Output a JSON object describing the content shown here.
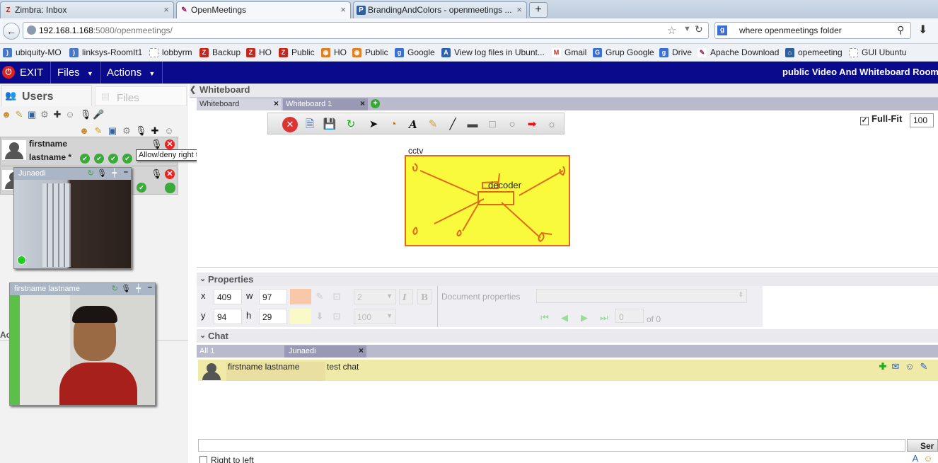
{
  "browser": {
    "tabs": [
      {
        "label": "Zimbra: Inbox",
        "favicon": "Z"
      },
      {
        "label": "OpenMeetings",
        "favicon": "feather"
      },
      {
        "label": "BrandingAndColors - openmeetings ...",
        "favicon": "P"
      }
    ],
    "new_tab": "+",
    "url_host": "192.168.1.168",
    "url_rest": ":5080/openmeetings/",
    "search_value": "where openmeetings folder",
    "bookmarks": [
      "ubiquity-MO",
      "linksys-RoomIt1",
      "lobbyrm",
      "Backup",
      "HO",
      "Public",
      "HO",
      "Public",
      "Google",
      "View log files in Ubunt...",
      "Gmail",
      "Grup Google",
      "Drive",
      "Apache Download",
      "opemeeting",
      "GUI Ubuntu"
    ]
  },
  "app": {
    "exit_label": "EXIT",
    "files_label": "Files",
    "actions_label": "Actions",
    "room_title": "public Video And Whiteboard Room"
  },
  "left": {
    "users_tab": "Users",
    "files_tab": "Files",
    "user1_first": "firstname",
    "user1_last": "lastname *",
    "tooltip": "Allow/deny right to give exclusive audio.",
    "video1_name": "Junaedi",
    "video2_name": "firstname lastname",
    "partial_label": "Ac"
  },
  "whiteboard": {
    "section_title": "Whiteboard",
    "tab1": "Whiteboard",
    "tab2": "Whiteboard 1",
    "fullfit_label": "Full-Fit",
    "zoom": "100",
    "cctv_text": "cctv",
    "decoder_text": "decoder",
    "shape_fill": "#fafa3c",
    "shape_stroke": "#e06a1a"
  },
  "properties": {
    "section_title": "Properties",
    "x_label": "x",
    "x_value": "409",
    "w_label": "w",
    "w_value": "97",
    "y_label": "y",
    "y_value": "94",
    "h_label": "h",
    "h_value": "29",
    "line_width": "2",
    "opacity": "100",
    "italic": "I",
    "bold": "B",
    "doc_props_label": "Document properties",
    "page_value": "0",
    "page_of": "of 0"
  },
  "chat": {
    "section_title": "Chat",
    "tab_all": "All 1",
    "tab_user": "Junaedi",
    "msg_name": "firstname lastname",
    "msg_text": "test chat",
    "send_label": "Ser",
    "rtl_label": "Right to left"
  }
}
